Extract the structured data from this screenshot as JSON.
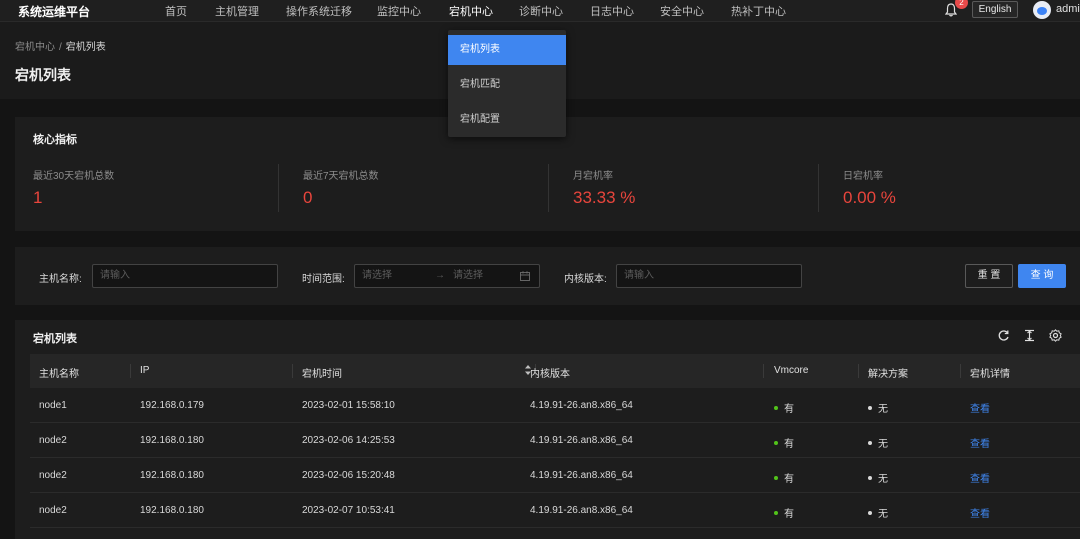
{
  "app": {
    "title": "系统运维平台"
  },
  "nav": {
    "items": [
      "首页",
      "主机管理",
      "操作系统迁移",
      "监控中心",
      "宕机中心",
      "诊断中心",
      "日志中心",
      "安全中心",
      "热补丁中心"
    ],
    "notification_count": "2",
    "language": "English",
    "user": "admi"
  },
  "dropdown": {
    "items": [
      "宕机列表",
      "宕机匹配",
      "宕机配置"
    ]
  },
  "breadcrumb": {
    "parent": "宕机中心",
    "separator": "/",
    "current": "宕机列表"
  },
  "page": {
    "title": "宕机列表"
  },
  "metrics": {
    "title": "核心指标",
    "items": [
      {
        "label": "最近30天宕机总数",
        "value": "1"
      },
      {
        "label": "最近7天宕机总数",
        "value": "0"
      },
      {
        "label": "月宕机率",
        "value": "33.33 %"
      },
      {
        "label": "日宕机率",
        "value": "0.00 %"
      }
    ]
  },
  "filter": {
    "host_label": "主机名称:",
    "host_placeholder": "请输入",
    "time_label": "时间范围:",
    "time_start_placeholder": "请选择",
    "time_arrow": "→",
    "time_end_placeholder": "请选择",
    "kernel_label": "内核版本:",
    "kernel_placeholder": "请输入",
    "reset": "重 置",
    "query": "查 询"
  },
  "table": {
    "title": "宕机列表",
    "columns": [
      "主机名称",
      "IP",
      "宕机时间",
      "内核版本",
      "Vmcore",
      "解决方案",
      "宕机详情"
    ],
    "rows": [
      {
        "host": "node1",
        "ip": "192.168.0.179",
        "time": "2023-02-01 15:58:10",
        "kernel": "4.19.91-26.an8.x86_64",
        "vmcore": "有",
        "solution": "无",
        "detail": "查看"
      },
      {
        "host": "node2",
        "ip": "192.168.0.180",
        "time": "2023-02-06 14:25:53",
        "kernel": "4.19.91-26.an8.x86_64",
        "vmcore": "有",
        "solution": "无",
        "detail": "查看"
      },
      {
        "host": "node2",
        "ip": "192.168.0.180",
        "time": "2023-02-06 15:20:48",
        "kernel": "4.19.91-26.an8.x86_64",
        "vmcore": "有",
        "solution": "无",
        "detail": "查看"
      },
      {
        "host": "node2",
        "ip": "192.168.0.180",
        "time": "2023-02-07 10:53:41",
        "kernel": "4.19.91-26.an8.x86_64",
        "vmcore": "有",
        "solution": "无",
        "detail": "查看"
      }
    ]
  },
  "colors": {
    "accent": "#3f86f0",
    "danger": "#e8453c",
    "vmcore_dot": "#52c41a",
    "solution_dot": "#d9d9d9"
  },
  "icons": {
    "notification": "bell-icon",
    "reload": "reload-icon",
    "density": "column-height-icon",
    "settings": "setting-icon",
    "calendar": "calendar-icon",
    "sort": "sort-icon"
  }
}
